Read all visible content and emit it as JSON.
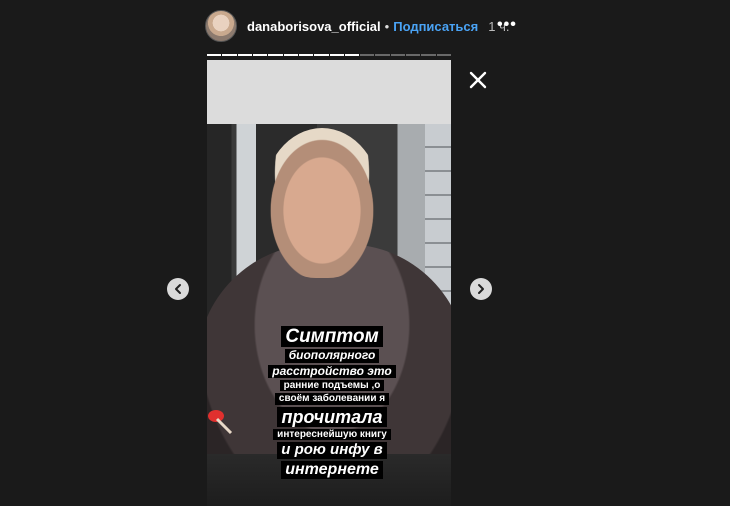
{
  "header": {
    "username": "danaborisova_official",
    "separator": "•",
    "follow_label": "Подписаться",
    "time": "1 ч.",
    "more_label": "•••"
  },
  "progress": {
    "segments": 16,
    "completed": 10
  },
  "story": {
    "caption_lines": [
      "Симптом",
      "биополярного",
      "расстройство это",
      "ранние подъемы ,о",
      "своём заболевании я",
      "прочитала",
      "интереснейшую книгу",
      "и рою инфу в",
      "интернете"
    ]
  },
  "icons": {
    "close": "close-icon",
    "prev": "chevron-left-icon",
    "next": "chevron-right-icon",
    "more": "more-dots-icon"
  },
  "colors": {
    "background": "#1a1a1a",
    "follow": "#4aa3f5",
    "nav_button": "#dadada"
  }
}
